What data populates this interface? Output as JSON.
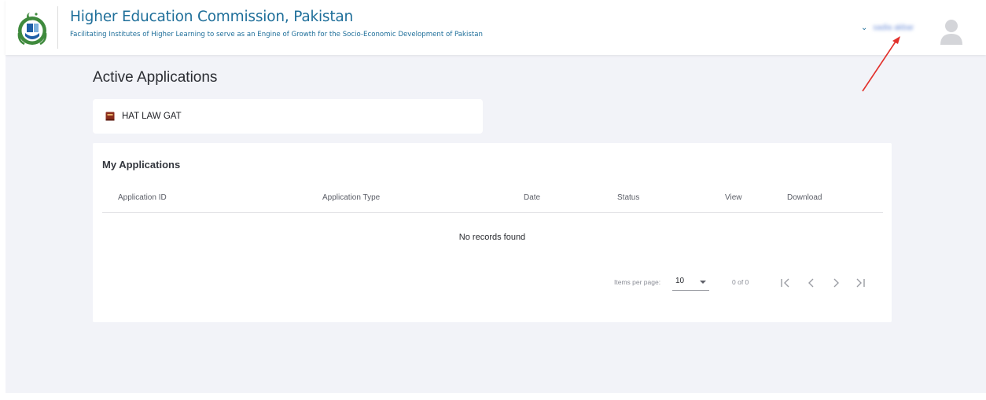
{
  "header": {
    "title": "Higher Education Commission, Pakistan",
    "tagline": "Facilitating Institutes of Higher Learning to serve as an Engine of Growth for the Socio-Economic Development of Pakistan",
    "logo_icon": "hec-logo-icon",
    "user_menu": {
      "chevron_icon": "chevron-down-icon",
      "username": "sadia akbar",
      "avatar_icon": "user-avatar-icon"
    }
  },
  "colors": {
    "brand": "#1f6f9a",
    "background": "#f2f3f8",
    "card": "#ffffff",
    "annotation_arrow": "#e2302b"
  },
  "active_applications": {
    "heading": "Active Applications",
    "items": [
      {
        "label": "HAT LAW GAT",
        "icon": "book-icon"
      }
    ]
  },
  "my_applications": {
    "heading": "My Applications",
    "columns": [
      "Application ID",
      "Application Type",
      "Date",
      "Status",
      "View",
      "Download"
    ],
    "rows": [],
    "empty_text": "No records found",
    "paginator": {
      "items_per_page_label": "Items per page:",
      "items_per_page_value": "10",
      "range_label": "0 of 0",
      "first_icon": "first-page-icon",
      "prev_icon": "chevron-left-icon",
      "next_icon": "chevron-right-icon",
      "last_icon": "last-page-icon"
    }
  }
}
